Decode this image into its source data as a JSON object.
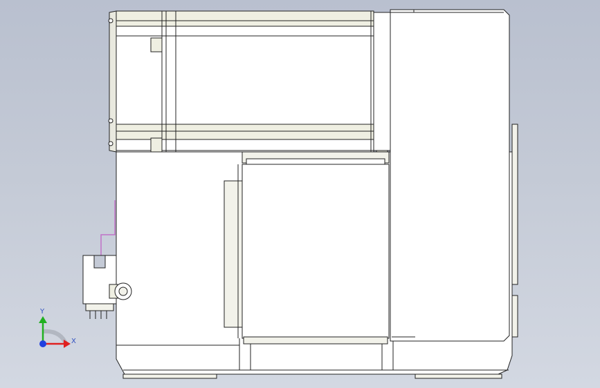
{
  "colors": {
    "body_fill": "#ffffff",
    "shade_fill": "#e9e9df",
    "outline": "#202020",
    "wire": "#c070c8",
    "axis_x": "#e02020",
    "axis_y": "#20b020",
    "axis_z": "#2040e0",
    "tan": "#efefe2"
  },
  "triad": {
    "x_label": "X",
    "y_label": "Y"
  }
}
